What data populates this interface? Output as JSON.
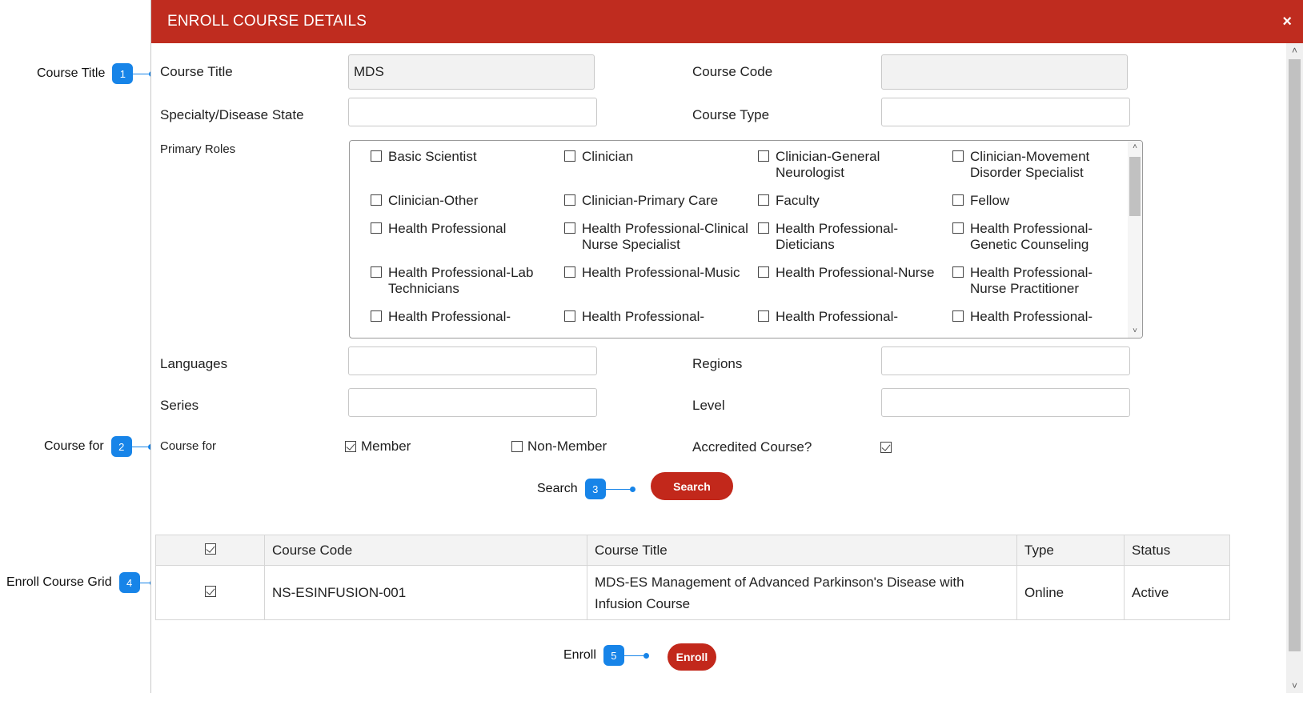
{
  "modal": {
    "title": "ENROLL COURSE DETAILS",
    "close_glyph": "×"
  },
  "callouts": [
    {
      "label": "Course Title",
      "number": "1"
    },
    {
      "label": "Course for",
      "number": "2"
    },
    {
      "label": "Search",
      "number": "3"
    },
    {
      "label": "Enroll Course Grid",
      "number": "4"
    },
    {
      "label": "Enroll",
      "number": "5"
    }
  ],
  "form": {
    "course_title": {
      "label": "Course Title",
      "value": "MDS"
    },
    "course_code": {
      "label": "Course Code",
      "value": ""
    },
    "specialty": {
      "label": "Specialty/Disease State",
      "value": ""
    },
    "course_type": {
      "label": "Course Type",
      "value": ""
    },
    "primary_roles_label": "Primary Roles",
    "languages": {
      "label": "Languages",
      "value": ""
    },
    "regions": {
      "label": "Regions",
      "value": ""
    },
    "series": {
      "label": "Series",
      "value": ""
    },
    "level": {
      "label": "Level",
      "value": ""
    },
    "course_for": {
      "label": "Course for",
      "member": {
        "label": "Member",
        "checked": true
      },
      "non_member": {
        "label": "Non-Member",
        "checked": false
      }
    },
    "accredited": {
      "label": "Accredited Course?",
      "checked": true
    }
  },
  "primary_roles": [
    {
      "label": "Basic Scientist",
      "checked": false
    },
    {
      "label": "Clinician",
      "checked": false
    },
    {
      "label": "Clinician-General Neurologist",
      "checked": false
    },
    {
      "label": "Clinician-Movement Disorder Specialist",
      "checked": false
    },
    {
      "label": "Clinician-Other",
      "checked": false
    },
    {
      "label": "Clinician-Primary Care",
      "checked": false
    },
    {
      "label": "Faculty",
      "checked": false
    },
    {
      "label": "Fellow",
      "checked": false
    },
    {
      "label": "Health Professional",
      "checked": false
    },
    {
      "label": "Health Professional-Clinical Nurse Specialist",
      "checked": false
    },
    {
      "label": "Health Professional-Dieticians",
      "checked": false
    },
    {
      "label": "Health Professional-Genetic Counseling",
      "checked": false
    },
    {
      "label": "Health Professional-Lab Technicians",
      "checked": false
    },
    {
      "label": "Health Professional-Music",
      "checked": false
    },
    {
      "label": "Health Professional-Nurse",
      "checked": false
    },
    {
      "label": "Health Professional-Nurse Practitioner",
      "checked": false
    },
    {
      "label": "Health Professional-",
      "checked": false
    },
    {
      "label": "Health Professional-",
      "checked": false
    },
    {
      "label": "Health Professional-",
      "checked": false
    },
    {
      "label": "Health Professional-",
      "checked": false
    }
  ],
  "buttons": {
    "search": "Search",
    "enroll": "Enroll"
  },
  "grid": {
    "columns": [
      "Course Code",
      "Course Title",
      "Type",
      "Status"
    ],
    "header_checked": true,
    "rows": [
      {
        "checked": true,
        "course_code": "NS-ESINFUSION-001",
        "course_title": "MDS-ES Management of Advanced Parkinson's Disease with Infusion Course",
        "type": "Online",
        "status": "Active"
      }
    ]
  },
  "colors": {
    "header_red": "#bf2c1f",
    "button_red": "#c2281b",
    "callout_blue": "#1784e8"
  }
}
